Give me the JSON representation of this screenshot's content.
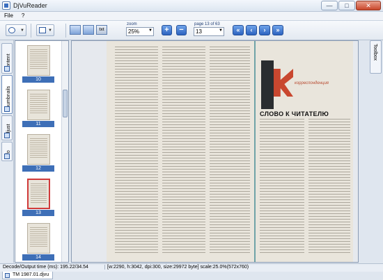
{
  "window": {
    "title": "DjVuReader",
    "minimize": "—",
    "maximize": "□",
    "close": "✕"
  },
  "menu": {
    "items": [
      "File",
      "?"
    ]
  },
  "toolbar": {
    "view_txt": "txt",
    "zoom_label": "zoom",
    "zoom_value": "25%",
    "zoom_in": "+",
    "zoom_out": "−",
    "page_label": "page 13 of 63",
    "page_value": "13",
    "first": "«",
    "prev": "‹",
    "next": "›",
    "last": "»"
  },
  "side_tabs": [
    "Content",
    "Thumbnails",
    "Adjust",
    "Info"
  ],
  "thumbnails": [
    {
      "num": "10"
    },
    {
      "num": "11"
    },
    {
      "num": "12"
    },
    {
      "num": "13",
      "selected": true
    },
    {
      "num": "14"
    }
  ],
  "document": {
    "heading": "СЛОВО К ЧИТАТЕЛЮ",
    "banner": "корреспонденция"
  },
  "toolbox": {
    "label": "Toolbox"
  },
  "status": {
    "decode": "Decode/Output time (ms): 195.22/34.54",
    "info": "[w:2290, h:3042, dpi:300, size:29972 byte] scale:25.0%(572x760)"
  },
  "doc_tab": {
    "label": "TM 1987.01.djvu"
  },
  "colors": {
    "accent": "#3e6fb7",
    "selection": "#d03a3a"
  }
}
